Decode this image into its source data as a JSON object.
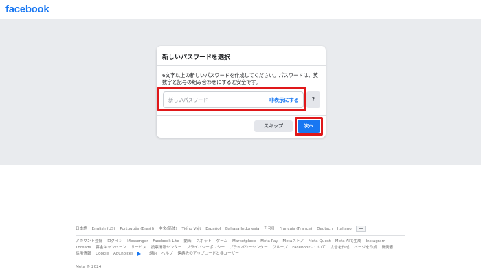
{
  "header": {
    "logo": "facebook"
  },
  "card": {
    "title": "新しいパスワードを選択",
    "description": "6文字以上の新しいパスワードを作成してください。パスワードは、英数字と記号の組み合わせにすると安全です。",
    "password_placeholder": "新しいパスワード",
    "hide_label": "非表示にする",
    "help_label": "?",
    "skip_label": "スキップ",
    "next_label": "次へ"
  },
  "footer": {
    "languages": [
      "日本語",
      "English (US)",
      "Português (Brasil)",
      "中文(简体)",
      "Tiếng Việt",
      "Español",
      "Bahasa Indonesia",
      "한국어",
      "Français (France)",
      "Deutsch",
      "Italiano"
    ],
    "plus_label": "+",
    "links": [
      "アカウント登録",
      "ログイン",
      "Messenger",
      "Facebook Lite",
      "動画",
      "スポット",
      "ゲーム",
      "Marketplace",
      "Meta Pay",
      "Metaストア",
      "Meta Quest",
      "Meta AIで生成",
      "Instagram",
      "Threads",
      "募金キャンペーン",
      "サービス",
      "投票情報センター",
      "プライバシーポリシー",
      "プライバシーセンター",
      "グループ",
      "Facebookについて",
      "広告を作成",
      "ページを作成",
      "開発者",
      "採用情報",
      "Cookie",
      "AdChoices",
      "規約",
      "ヘルプ",
      "連絡先のアップロードと非ユーザー"
    ],
    "copyright": "Meta © 2024"
  },
  "colors": {
    "brand": "#1877f2",
    "highlight": "#e0181a",
    "page_bg": "#e9ebee"
  }
}
